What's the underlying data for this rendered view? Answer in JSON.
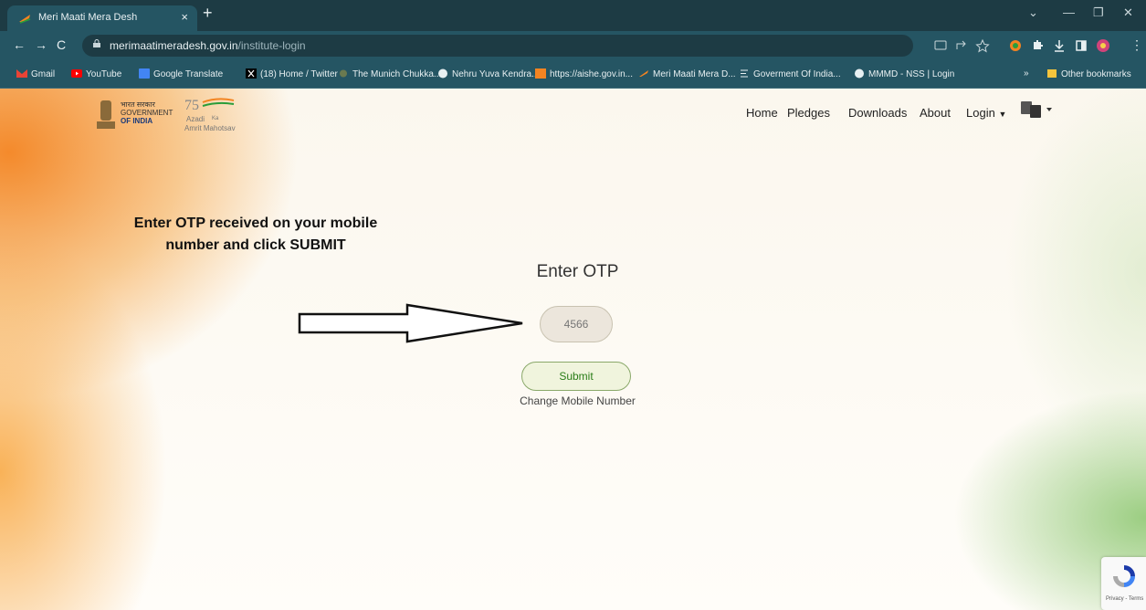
{
  "browser": {
    "tab_title": "Meri Maati Mera Desh",
    "tab_close": "×",
    "new_tab": "+",
    "url_domain": "merimaatimeradesh.gov.in",
    "url_path": "/institute-login",
    "bookmarks": [
      {
        "label": "Gmail"
      },
      {
        "label": "YouTube"
      },
      {
        "label": "Google Translate"
      },
      {
        "label": "(18) Home / Twitter"
      },
      {
        "label": "The Munich Chukka..."
      },
      {
        "label": "Nehru Yuva Kendra..."
      },
      {
        "label": "https://aishe.gov.in..."
      },
      {
        "label": "Meri Maati Mera D..."
      },
      {
        "label": "Goverment Of India..."
      },
      {
        "label": "MMMD - NSS | Login"
      }
    ],
    "overflow": "»",
    "other_bookmarks": "Other bookmarks"
  },
  "header": {
    "gov_hindi": "भारत सरकार",
    "gov_line1": "GOVERNMENT",
    "gov_line2": "OF INDIA",
    "ak_line1": "Azadi",
    "ak_ka": "Ka",
    "ak_line2": "Amrit Mahotsav",
    "nav": [
      "Home",
      "Pledges",
      "Downloads",
      "About",
      "Login"
    ]
  },
  "main": {
    "instruction_line1": "Enter OTP received on your mobile",
    "instruction_line2": "number and click SUBMIT",
    "otp_title": "Enter OTP",
    "otp_placeholder": "4566",
    "submit_label": "Submit",
    "change_mobile": "Change Mobile Number"
  },
  "recaptcha": {
    "label": "Privacy - Terms"
  },
  "colors": {
    "chrome_dark": "#1d3b44",
    "chrome_mid": "#255563",
    "saffron": "#f38421",
    "green": "#2a7d18"
  }
}
